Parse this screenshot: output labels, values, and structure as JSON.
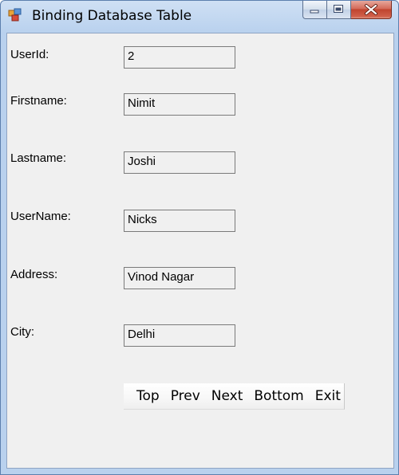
{
  "window": {
    "title": "Binding Database Table",
    "accent": "#b9d1ee",
    "close_color": "#c0442e"
  },
  "caption_buttons": {
    "minimize_icon": "minimize-icon",
    "maximize_icon": "maximize-icon",
    "close_icon": "close-icon"
  },
  "form": {
    "userid_label": "UserId:",
    "userid_value": "2",
    "firstname_label": "Firstname:",
    "firstname_value": "Nimit",
    "lastname_label": "Lastname:",
    "lastname_value": "Joshi",
    "username_label": "UserName:",
    "username_value": "Nicks",
    "address_label": "Address:",
    "address_value": "Vinod Nagar",
    "city_label": "City:",
    "city_value": "Delhi"
  },
  "toolbar": {
    "top": "Top",
    "prev": "Prev",
    "next": "Next",
    "bottom": "Bottom",
    "exit": "Exit"
  }
}
